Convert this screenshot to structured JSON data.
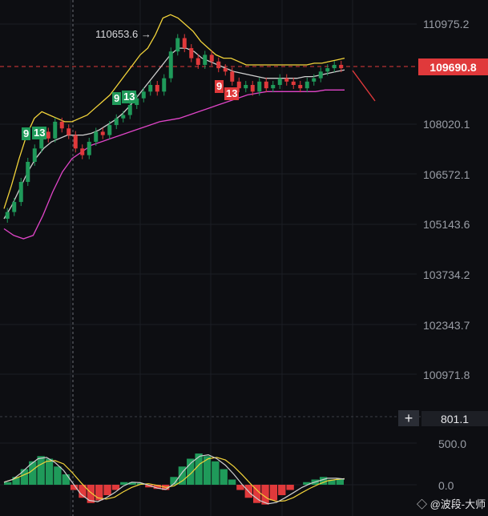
{
  "price_axis": {
    "labels": [
      "110975.2",
      "108020.1",
      "106572.1",
      "105143.6",
      "103734.2",
      "102343.7",
      "100971.8"
    ],
    "current_price": "109690.8"
  },
  "peak_label": "110653.6 →",
  "td_markers": [
    {
      "text": "9",
      "color": "green"
    },
    {
      "text": "13",
      "color": "green"
    },
    {
      "text": "9",
      "color": "green"
    },
    {
      "text": "13",
      "color": "green"
    },
    {
      "text": "9",
      "color": "red"
    },
    {
      "text": "13",
      "color": "red"
    }
  ],
  "oscillator": {
    "crosshair_value": "801.1",
    "labels": [
      "500.0",
      "0.0"
    ]
  },
  "watermark": "◇ @波段-大师",
  "colors": {
    "background": "#0d0e12",
    "up": "#1f9a5a",
    "down": "#e0393b",
    "upper_band": "#f2d33a",
    "middle_band": "#d0d0d0",
    "lower_band": "#e045c8"
  },
  "chart_data": {
    "type": "candlestick",
    "price_range": [
      100000,
      111500
    ],
    "closes": [
      105400,
      105700,
      106300,
      106900,
      107300,
      107800,
      107600,
      108100,
      107900,
      107700,
      107300,
      107100,
      107500,
      107800,
      107700,
      108000,
      108200,
      108300,
      108600,
      108800,
      109000,
      109200,
      109000,
      109400,
      110200,
      110600,
      110300,
      110000,
      109800,
      110100,
      109900,
      109700,
      109600,
      109300,
      109100,
      109200,
      109000,
      109300,
      109100,
      109200,
      109400,
      109300,
      109200,
      109100,
      109300,
      109400,
      109600,
      109700,
      109800,
      109700
    ],
    "upper_band": [
      105500,
      106200,
      107000,
      107700,
      108200,
      108400,
      108300,
      108200,
      108100,
      108100,
      108200,
      108300,
      108500,
      108700,
      108900,
      109200,
      109500,
      109800,
      110100,
      110300,
      110700,
      111200,
      111300,
      111200,
      111000,
      110800,
      110500,
      110300,
      110100,
      110000,
      110000,
      109900,
      109800,
      109800,
      109800,
      109800,
      109800,
      109800,
      109800,
      109800,
      109800,
      109850,
      109850,
      109900,
      109950,
      110000
    ],
    "middle_band": [
      105200,
      105600,
      106100,
      106600,
      107000,
      107300,
      107500,
      107600,
      107700,
      107700,
      107700,
      107750,
      107850,
      108000,
      108150,
      108350,
      108600,
      108900,
      109200,
      109500,
      109800,
      110100,
      110300,
      110300,
      110200,
      110000,
      109900,
      109800,
      109700,
      109600,
      109550,
      109500,
      109450,
      109400,
      109400,
      109400,
      109400,
      109400,
      109450,
      109450,
      109500,
      109550,
      109600,
      109650
    ],
    "lower_band": [
      104900,
      104700,
      104600,
      104700,
      105300,
      106000,
      106600,
      107000,
      107200,
      107400,
      107500,
      107600,
      107700,
      107800,
      107900,
      108000,
      108100,
      108150,
      108200,
      108300,
      108400,
      108500,
      108600,
      108700,
      108800,
      108900,
      108950,
      109000,
      109000,
      109000,
      109000,
      109000,
      109000,
      109050,
      109050,
      109050
    ],
    "oscillator_histogram": [
      50,
      150,
      300,
      450,
      550,
      500,
      350,
      200,
      -100,
      -250,
      -350,
      -300,
      -200,
      -100,
      50,
      50,
      30,
      -50,
      -80,
      -100,
      150,
      350,
      500,
      600,
      550,
      450,
      300,
      100,
      -100,
      -250,
      -350,
      -380,
      -300,
      -200,
      -100,
      0,
      50,
      100,
      150,
      100,
      120
    ],
    "oscillator_range": [
      -300,
      800
    ]
  }
}
